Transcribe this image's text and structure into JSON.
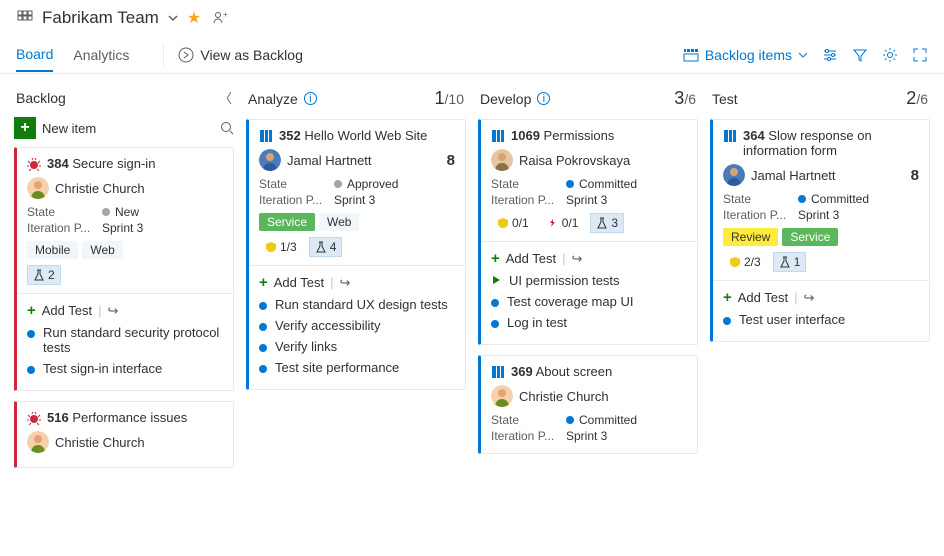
{
  "header": {
    "team_name": "Fabrikam Team"
  },
  "tabs": {
    "board": "Board",
    "analytics": "Analytics",
    "backlog_view": "View as Backlog"
  },
  "toolbar": {
    "backlog_items": "Backlog items"
  },
  "columns": {
    "backlog": {
      "title": "Backlog",
      "new_item": "New item"
    },
    "analyze": {
      "title": "Analyze",
      "count": "1",
      "max": "/10"
    },
    "develop": {
      "title": "Develop",
      "count": "3",
      "max": "/6"
    },
    "test": {
      "title": "Test",
      "count": "2",
      "max": "/6"
    }
  },
  "meta": {
    "state": "State",
    "iteration": "Iteration P..."
  },
  "states": {
    "new": "New",
    "approved": "Approved",
    "committed": "Committed"
  },
  "add_test": "Add Test",
  "cards": {
    "c384": {
      "id": "384",
      "title": "Secure sign-in",
      "assignee": "Christie Church",
      "iteration": "Sprint 3",
      "tags": [
        "Mobile",
        "Web"
      ],
      "flask": "2",
      "tests": [
        "Run standard security protocol tests",
        "Test sign-in interface"
      ]
    },
    "c516": {
      "id": "516",
      "title": "Performance issues",
      "assignee": "Christie Church"
    },
    "c352": {
      "id": "352",
      "title": "Hello World Web Site",
      "assignee": "Jamal Hartnett",
      "effort": "8",
      "iteration": "Sprint 3",
      "shield": "1/3",
      "flask": "4",
      "tests": [
        "Run standard UX design tests",
        "Verify accessibility",
        "Verify links",
        "Test site performance"
      ]
    },
    "c1069": {
      "id": "1069",
      "title": "Permissions",
      "assignee": "Raisa Pokrovskaya",
      "iteration": "Sprint 3",
      "shield": "0/1",
      "bug": "0/1",
      "flask": "3",
      "tests": [
        "UI permission tests",
        "Test coverage map UI",
        "Log in test"
      ]
    },
    "c369": {
      "id": "369",
      "title": "About screen",
      "assignee": "Christie Church",
      "iteration": "Sprint 3"
    },
    "c364": {
      "id": "364",
      "title": "Slow response on information form",
      "assignee": "Jamal Hartnett",
      "effort": "8",
      "iteration": "Sprint 3",
      "shield": "2/3",
      "flask": "1",
      "tests": [
        "Test user interface"
      ]
    }
  },
  "tag_labels": {
    "service": "Service",
    "web": "Web",
    "review": "Review"
  }
}
